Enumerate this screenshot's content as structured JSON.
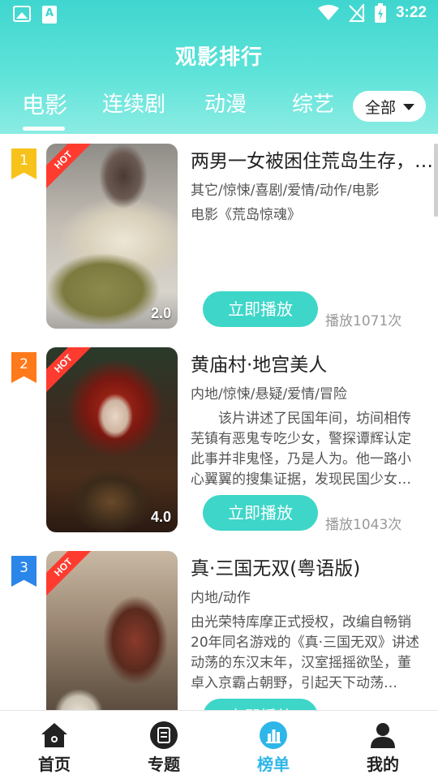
{
  "status_bar": {
    "time": "3:22"
  },
  "header": {
    "title": "观影排行"
  },
  "tabs": [
    {
      "label": "电影"
    },
    {
      "label": "连续剧"
    },
    {
      "label": "动漫"
    },
    {
      "label": "综艺"
    }
  ],
  "filter": {
    "label": "全部"
  },
  "items": [
    {
      "rank": "1",
      "badge": "HOT",
      "score": "2.0",
      "title": "两男一女被困住荒岛生存，遭遇…",
      "tags": "其它/惊悚/喜剧/爱情/动作/电影",
      "desc": "电影《荒岛惊魂》",
      "play_label": "立即播放",
      "play_count": "播放1071次"
    },
    {
      "rank": "2",
      "badge": "HOT",
      "score": "4.0",
      "title": "黄庙村·地宫美人",
      "tags": "内地/惊悚/悬疑/爱情/冒险",
      "desc": "　　该片讲述了民国年间，坊间相传芜镇有恶鬼专吃少女，警探谭辉认定此事并非鬼怪，乃是人为。他一路小心翼翼的搜集证据，发现民国少女…",
      "play_label": "立即播放",
      "play_count": "播放1043次"
    },
    {
      "rank": "3",
      "badge": "HOT",
      "score": "",
      "title": "真·三国无双(粤语版)",
      "tags": "内地/动作",
      "desc": "由光荣特库摩正式授权，改编自畅销20年同名游戏的《真·三国无双》讲述动荡的东汉末年，汉室摇摇欲坠，董卓入京霸占朝野，引起天下动荡…",
      "play_label": "立即播放",
      "play_count": ""
    }
  ],
  "bottom_nav": [
    {
      "label": "首页",
      "icon": "home-icon"
    },
    {
      "label": "专题",
      "icon": "topic-icon"
    },
    {
      "label": "榜单",
      "icon": "ranking-icon"
    },
    {
      "label": "我的",
      "icon": "profile-icon"
    }
  ],
  "colors": {
    "accent": "#3ed6c8",
    "nav_active": "#2fb6e8",
    "rank_1": "#f7c21a",
    "rank_2": "#ff7a1a",
    "rank_3": "#2a86e8",
    "hot_badge": "#ff3b30"
  }
}
